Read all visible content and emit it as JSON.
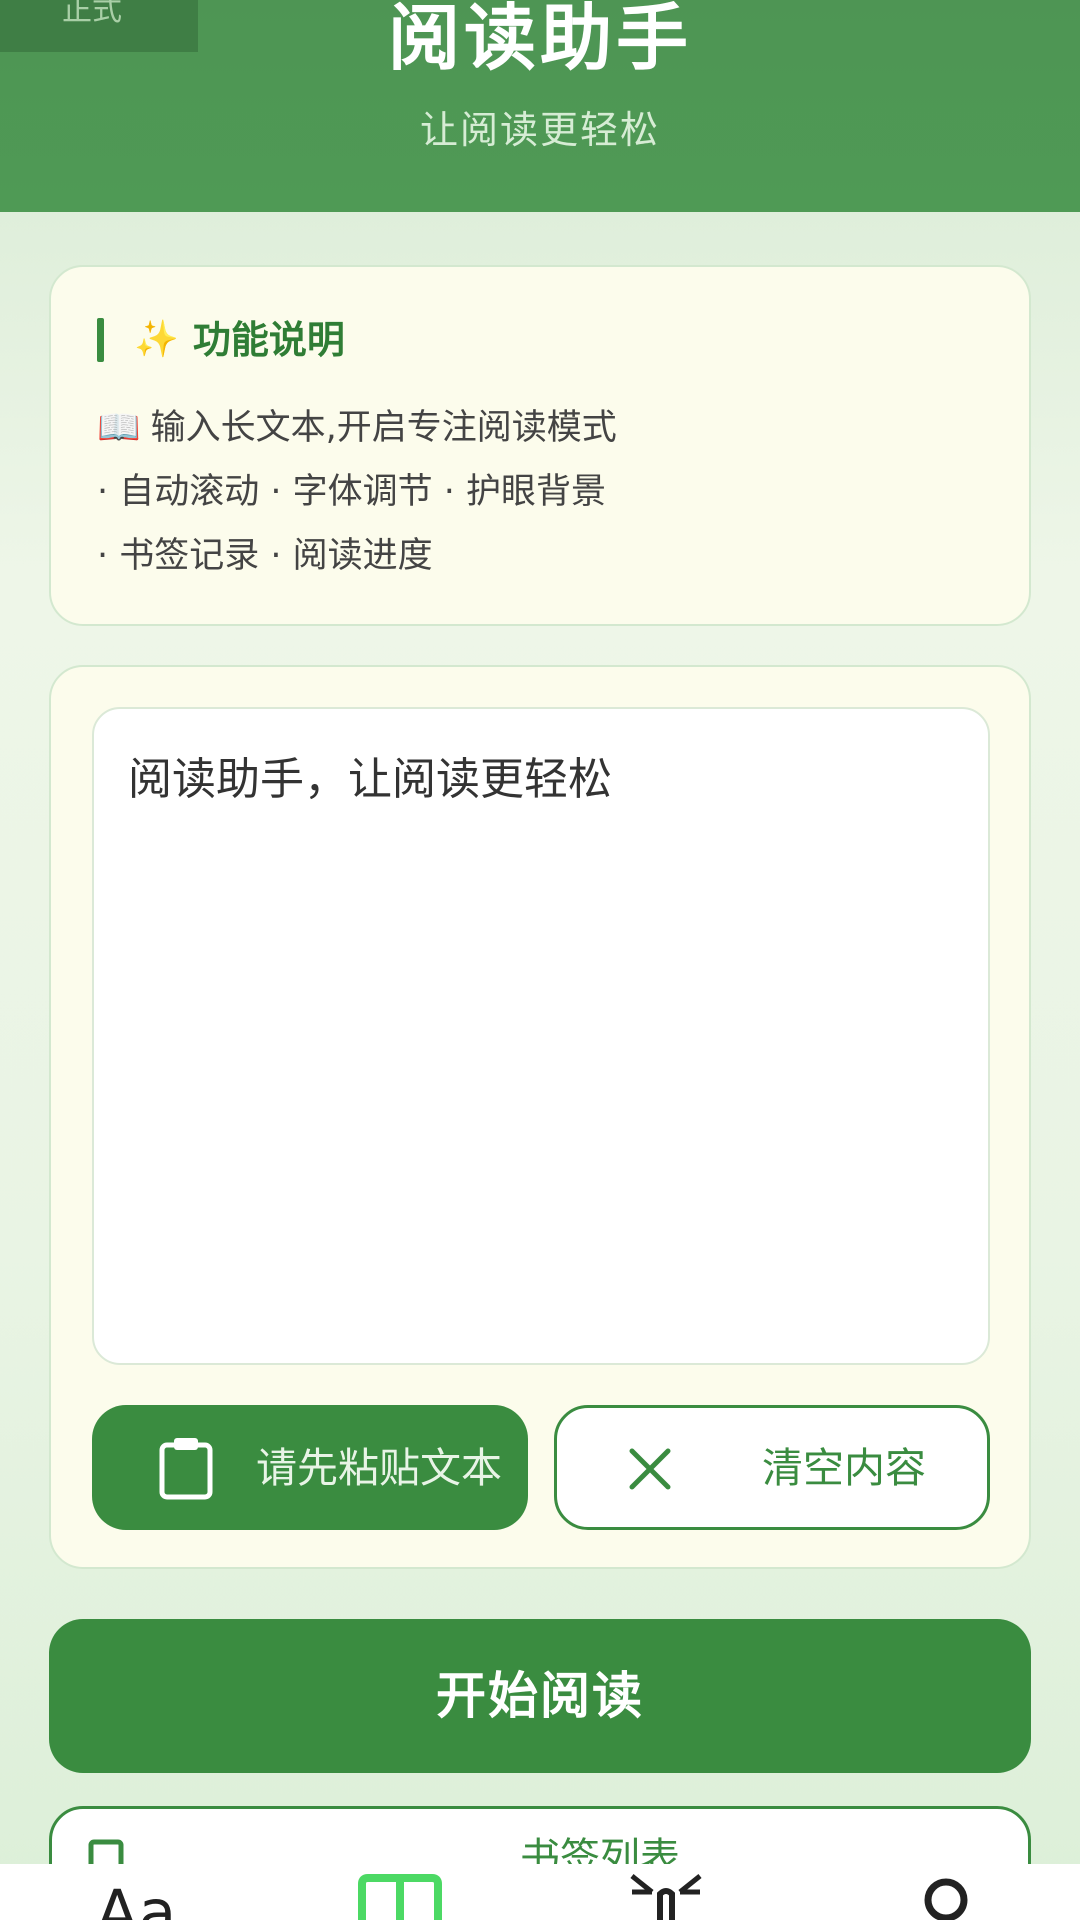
{
  "header": {
    "env_badge": "正式",
    "title": "阅读助手",
    "subtitle": "让阅读更轻松"
  },
  "features": {
    "sparkle_icon": "sparkles-icon",
    "title": "功能说明",
    "book_icon": "open-book-icon",
    "lines": [
      "输入长文本,开启专注阅读模式",
      "· 自动滚动 · 字体调节 · 护眼背景",
      "· 书签记录 · 阅读进度"
    ]
  },
  "editor": {
    "content": "阅读助手，让阅读更轻松"
  },
  "actions": {
    "paste_label": "请先粘贴文本",
    "paste_icon": "clipboard-icon",
    "clear_label": "清空内容",
    "clear_icon": "close-icon",
    "start_label": "开始阅读"
  },
  "bookmarks": {
    "label": "书签列表",
    "icon": "bookmark-icon"
  },
  "nav": {
    "items": [
      {
        "name": "font",
        "icon": "font-size-icon",
        "text": "Aa"
      },
      {
        "name": "reader",
        "icon": "book-icon",
        "active": true
      },
      {
        "name": "gesture",
        "icon": "tap-icon"
      },
      {
        "name": "profile",
        "icon": "user-icon"
      }
    ]
  },
  "colors": {
    "primary": "#3a8c40",
    "header": "#4f9a55",
    "card_bg": "#fcfcec"
  }
}
